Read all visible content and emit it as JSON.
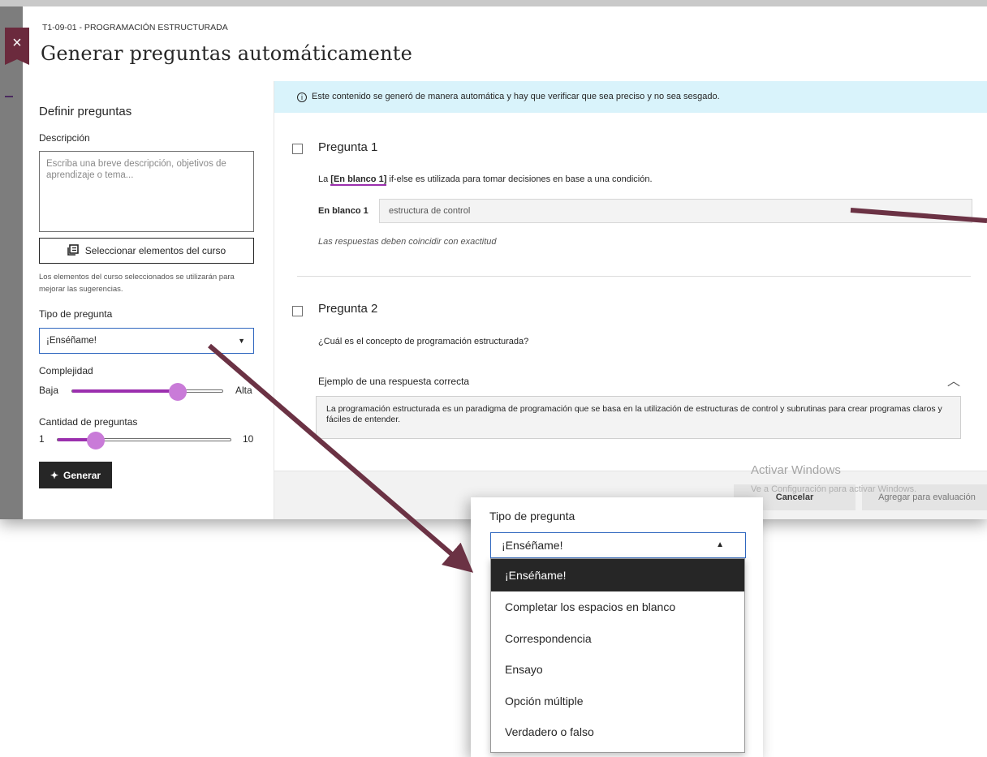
{
  "header": {
    "breadcrumb": "T1-09-01 - PROGRAMACIÓN ESTRUCTURADA",
    "title": "Generar preguntas automáticamente",
    "close_icon": "×"
  },
  "left_panel": {
    "heading": "Definir preguntas",
    "description_label": "Descripción",
    "description_placeholder": "Escriba una breve descripción, objetivos de aprendizaje o tema...",
    "select_course_button": "Seleccionar elementos del curso",
    "course_note": "Los elementos del curso seleccionados se utilizarán para mejorar las sugerencias.",
    "question_type_label": "Tipo de pregunta",
    "question_type_value": "¡Enséñame!",
    "complexity_label": "Complejidad",
    "complexity_low": "Baja",
    "complexity_high": "Alta",
    "complexity_level": 0.7,
    "count_label": "Cantidad de preguntas",
    "count_min": "1",
    "count_max": "10",
    "count_value": 3,
    "generate_button": "Generar"
  },
  "info_banner": "Este contenido se generó de manera automática y hay que verificar que sea preciso y no sea sesgado.",
  "questions": [
    {
      "title": "Pregunta 1",
      "blank_ref": "[En blanco 1]",
      "text_after": " if-else es utilizada para tomar decisiones en base a una condición.",
      "text_before": "La ",
      "blank_label": "En blanco 1",
      "blank_value": "estructura de control",
      "note": "Las respuestas deben coincidir con exactitud"
    },
    {
      "title": "Pregunta 2",
      "text": "¿Cuál es el concepto de programación estructurada?",
      "example_heading": "Ejemplo de una respuesta correcta",
      "example_answer": "La programación estructurada es un paradigma de programación que se basa en la utilización de estructuras de control y subrutinas para crear programas claros y fáciles de entender."
    }
  ],
  "footer": {
    "cancel": "Cancelar",
    "add": "Agregar para evaluación",
    "watermark_title": "Activar Windows",
    "watermark_sub": "Ve a Configuración para activar Windows."
  },
  "zoom_dropdown": {
    "label": "Tipo de pregunta",
    "selected": "¡Enséñame!",
    "options": [
      "¡Enséñame!",
      "Completar los espacios en blanco",
      "Correspondencia",
      "Ensayo",
      "Opción múltiple",
      "Verdadero o falso"
    ]
  },
  "colors": {
    "accent_purple": "#9b2fae",
    "arrow": "#6b3244",
    "banner": "#d9f3fb",
    "close": "#6b2a3d"
  }
}
